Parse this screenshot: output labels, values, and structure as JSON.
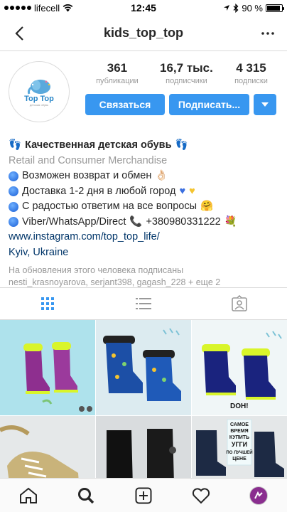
{
  "status_bar": {
    "carrier": "lifecell",
    "time": "12:45",
    "battery_text": "90 %",
    "battery_level": 0.9
  },
  "header": {
    "title": "kids_top_top",
    "back_icon": "chevron-left-icon",
    "more_icon": "ellipsis-icon"
  },
  "profile": {
    "avatar_text": "Top Top",
    "avatar_tagline": "детская обувь",
    "stats": [
      {
        "value": "361",
        "label": "публикации"
      },
      {
        "value": "16,7 тыс.",
        "label": "подписчики"
      },
      {
        "value": "4 315",
        "label": "подписки"
      }
    ],
    "contact_label": "Связаться",
    "follow_label": "Подписать...",
    "brand_color": "#3897f0"
  },
  "bio": {
    "name": "Качественная детская обувь",
    "category": "Retail and Consumer Merchandise",
    "line1": "Возможен возврат и обмен",
    "line2": "Доставка 1-2 дня в любой город",
    "line3": "С радостью ответим на все вопросы",
    "line4": "Viber/WhatsApp/Direct",
    "phone": "+380980331222",
    "link": "www.instagram.com/top_top_life/",
    "location": "Kyiv, Ukraine",
    "followers_note": "На обновления этого человека подписаны",
    "followers_names": "nesti_krasnoyarova, serjant398, gagash_228 + еще 2"
  },
  "grid_sticker": "DOH!",
  "grid_text_card": [
    "САМОЕ",
    "ВРЕМЯ",
    "КУПИТЬ",
    "УГГИ",
    "ПО ЛУЧШЕЙ",
    "ЦЕНЕ"
  ]
}
